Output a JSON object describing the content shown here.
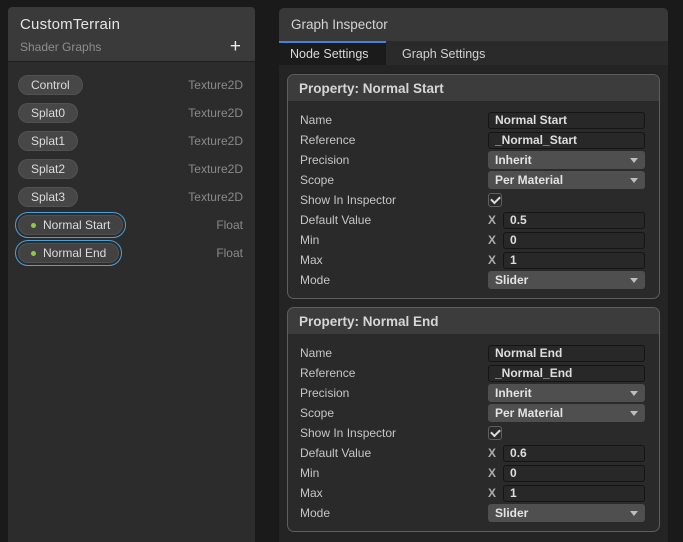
{
  "colors": {
    "accent_blue": "#4284d8",
    "selection_outline": "#4ba0d8",
    "dot_green": "#93c83e"
  },
  "blackboard": {
    "title": "CustomTerrain",
    "subtitle": "Shader Graphs",
    "add_button_label": "+",
    "items": [
      {
        "label": "Control",
        "type": "Texture2D",
        "selected": false
      },
      {
        "label": "Splat0",
        "type": "Texture2D",
        "selected": false
      },
      {
        "label": "Splat1",
        "type": "Texture2D",
        "selected": false
      },
      {
        "label": "Splat2",
        "type": "Texture2D",
        "selected": false
      },
      {
        "label": "Splat3",
        "type": "Texture2D",
        "selected": false
      },
      {
        "label": "Normal Start",
        "type": "Float",
        "selected": true
      },
      {
        "label": "Normal End",
        "type": "Float",
        "selected": true
      }
    ]
  },
  "inspector": {
    "title": "Graph Inspector",
    "tabs": [
      {
        "label": "Node Settings",
        "active": true
      },
      {
        "label": "Graph Settings",
        "active": false
      }
    ],
    "properties": [
      {
        "header": "Property: Normal Start",
        "rows": [
          {
            "label": "Name",
            "control": "text",
            "value": "Normal Start"
          },
          {
            "label": "Reference",
            "control": "text",
            "value": "_Normal_Start"
          },
          {
            "label": "Precision",
            "control": "dropdown",
            "value": "Inherit"
          },
          {
            "label": "Scope",
            "control": "dropdown",
            "value": "Per Material"
          },
          {
            "label": "Show In Inspector",
            "control": "checkbox",
            "value": true
          },
          {
            "label": "Default Value",
            "control": "vector",
            "axis": "X",
            "value": "0.5"
          },
          {
            "label": "Min",
            "control": "vector",
            "axis": "X",
            "value": "0"
          },
          {
            "label": "Max",
            "control": "vector",
            "axis": "X",
            "value": "1"
          },
          {
            "label": "Mode",
            "control": "dropdown",
            "value": "Slider"
          }
        ]
      },
      {
        "header": "Property: Normal End",
        "rows": [
          {
            "label": "Name",
            "control": "text",
            "value": "Normal End"
          },
          {
            "label": "Reference",
            "control": "text",
            "value": "_Normal_End"
          },
          {
            "label": "Precision",
            "control": "dropdown",
            "value": "Inherit"
          },
          {
            "label": "Scope",
            "control": "dropdown",
            "value": "Per Material"
          },
          {
            "label": "Show In Inspector",
            "control": "checkbox",
            "value": true
          },
          {
            "label": "Default Value",
            "control": "vector",
            "axis": "X",
            "value": "0.6"
          },
          {
            "label": "Min",
            "control": "vector",
            "axis": "X",
            "value": "0"
          },
          {
            "label": "Max",
            "control": "vector",
            "axis": "X",
            "value": "1"
          },
          {
            "label": "Mode",
            "control": "dropdown",
            "value": "Slider"
          }
        ]
      }
    ]
  }
}
